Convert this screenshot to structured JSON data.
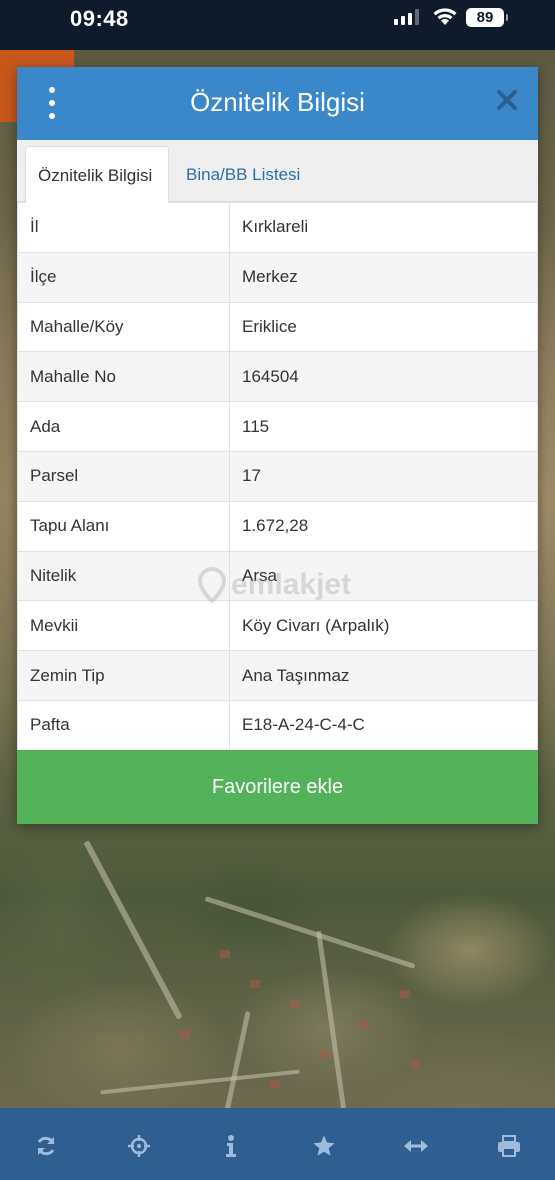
{
  "status_bar": {
    "time": "09:48",
    "battery": "89"
  },
  "modal": {
    "title": "Öznitelik Bilgisi",
    "tabs": [
      {
        "label": "Öznitelik Bilgisi",
        "active": true
      },
      {
        "label": "Bina/BB Listesi",
        "active": false
      }
    ],
    "rows": [
      {
        "key": "İl",
        "value": "Kırklareli"
      },
      {
        "key": "İlçe",
        "value": "Merkez"
      },
      {
        "key": "Mahalle/Köy",
        "value": "Eriklice"
      },
      {
        "key": "Mahalle No",
        "value": "164504"
      },
      {
        "key": "Ada",
        "value": "115"
      },
      {
        "key": "Parsel",
        "value": "17"
      },
      {
        "key": "Tapu Alanı",
        "value": "1.672,28"
      },
      {
        "key": "Nitelik",
        "value": "Arsa"
      },
      {
        "key": "Mevkii",
        "value": "Köy Civarı (Arpalık)"
      },
      {
        "key": "Zemin Tip",
        "value": "Ana Taşınmaz"
      },
      {
        "key": "Pafta",
        "value": "E18-A-24-C-4-C"
      }
    ],
    "favorite_label": "Favorilere ekle",
    "watermark": "emlakjet"
  },
  "toolbar": {
    "items": [
      "refresh-icon",
      "crosshair-icon",
      "info-icon",
      "star-icon",
      "arrows-horizontal-icon",
      "printer-icon"
    ]
  },
  "colors": {
    "header": "#3a87c9",
    "favorite": "#53b25a",
    "toolbar": "#2f5e91",
    "status_bar": "#0f1a2a"
  }
}
